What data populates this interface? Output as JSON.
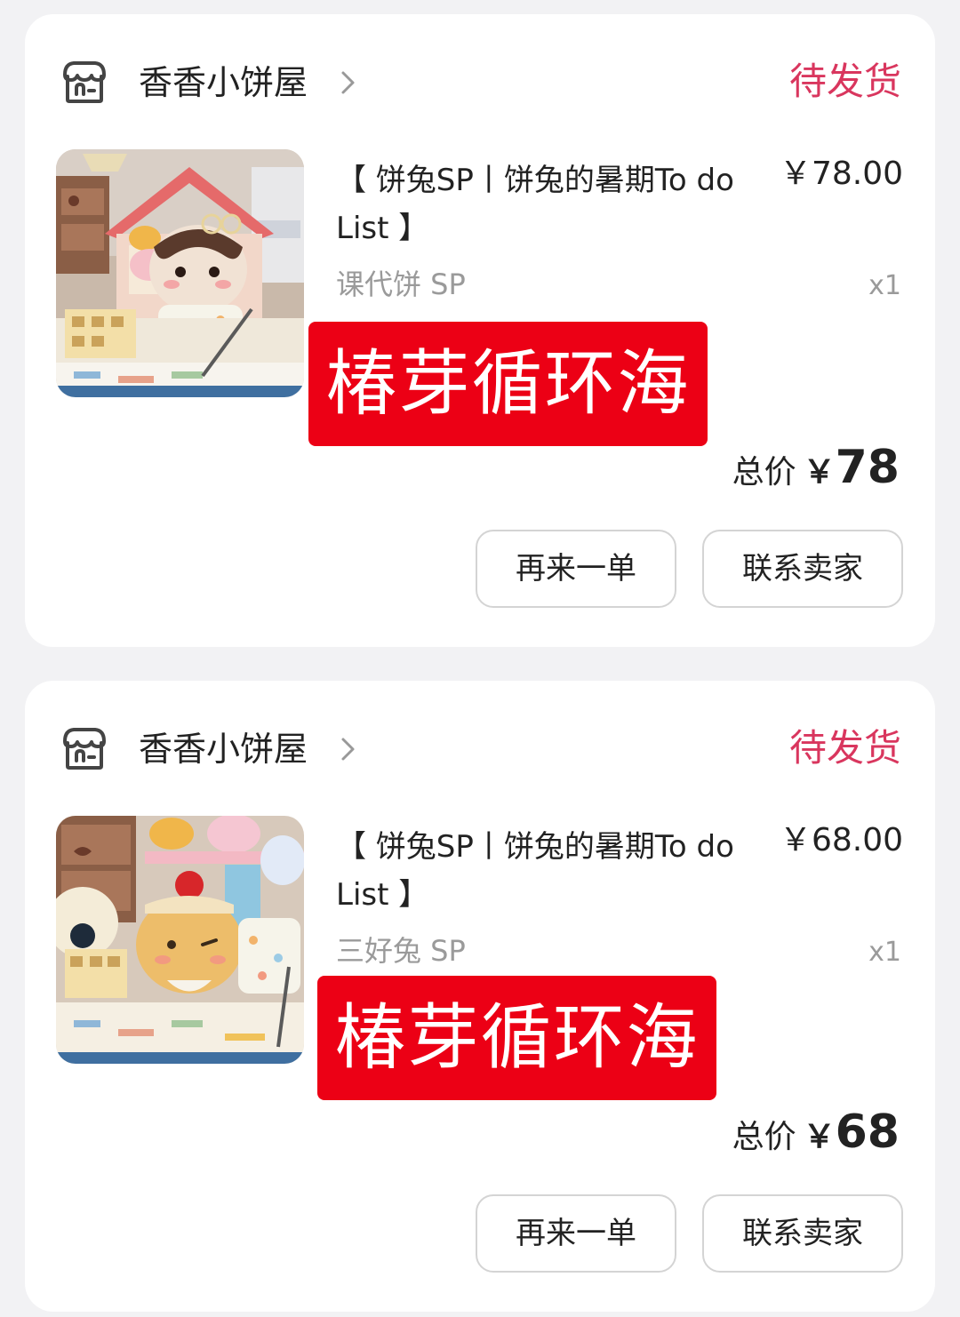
{
  "orders": [
    {
      "shop": {
        "name": "香香小饼屋",
        "icon": "shop-icon"
      },
      "status": "待发货",
      "product": {
        "title": "【 饼兔SP丨饼兔的暑期To do List 】",
        "price": "￥78.00",
        "variant": "课代饼 SP",
        "quantity": "x1",
        "image": "plush-doll-in-toy-house-photo"
      },
      "watermark": "椿芽循环海",
      "total": {
        "label": "总价",
        "currency": "￥",
        "amount": "78"
      },
      "buttons": {
        "reorder": "再来一单",
        "contact": "联系卖家"
      }
    },
    {
      "shop": {
        "name": "香香小饼屋",
        "icon": "shop-icon"
      },
      "status": "待发货",
      "product": {
        "title": "【 饼兔SP丨饼兔的暑期To do List 】",
        "price": "￥68.00",
        "variant": "三好兔 SP",
        "quantity": "x1",
        "image": "bunny-plush-with-purse-photo"
      },
      "watermark": "椿芽循环海",
      "total": {
        "label": "总价",
        "currency": "￥",
        "amount": "68"
      },
      "buttons": {
        "reorder": "再来一单",
        "contact": "联系卖家"
      }
    }
  ],
  "colors": {
    "status": "#d9365e",
    "watermark_bg": "#ec0015",
    "page_bg": "#f2f2f4"
  }
}
